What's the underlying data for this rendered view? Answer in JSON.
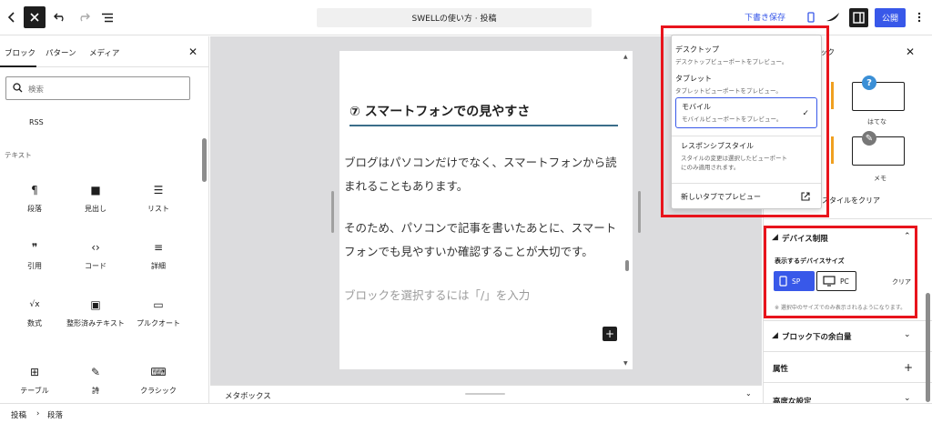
{
  "topbar": {
    "doc_title": "SWELLの使い方 · 投稿",
    "save_draft": "下書き保存",
    "publish": "公開",
    "accent": "#3858e9"
  },
  "inserter": {
    "tabs": [
      "ブロック",
      "パターン",
      "メディア"
    ],
    "search_placeholder": "検索",
    "rss": "RSS",
    "category": "テキスト",
    "blocks": [
      {
        "label": "段落",
        "icon": "paragraph-icon",
        "glyph": "¶"
      },
      {
        "label": "見出し",
        "icon": "bookmark-icon",
        "glyph": "■"
      },
      {
        "label": "リスト",
        "icon": "list-icon",
        "glyph": "☰"
      },
      {
        "label": "引用",
        "icon": "quote-icon",
        "glyph": "❞"
      },
      {
        "label": "コード",
        "icon": "code-icon",
        "glyph": "‹›"
      },
      {
        "label": "詳細",
        "icon": "details-icon",
        "glyph": "≡"
      },
      {
        "label": "数式",
        "icon": "math-icon",
        "glyph": "√x"
      },
      {
        "label": "整形済みテキスト",
        "icon": "preformatted-icon",
        "glyph": "▣"
      },
      {
        "label": "プルクオート",
        "icon": "pullquote-icon",
        "glyph": "▭"
      },
      {
        "label": "テーブル",
        "icon": "table-icon",
        "glyph": "⊞"
      },
      {
        "label": "詩",
        "icon": "feather-icon",
        "glyph": "✎"
      },
      {
        "label": "クラシック",
        "icon": "keyboard-icon",
        "glyph": "⌨"
      }
    ]
  },
  "canvas": {
    "heading": "⑦ スマートフォンでの見やすさ",
    "para1": "ブログはパソコンだけでなく、スマートフォンから読まれることもあります。",
    "para2": "そのため、パソコンで記事を書いたあとに、スマートフォンでも見やすいか確認することが大切です。",
    "placeholder": "ブロックを選択するには「/」を入力"
  },
  "metabox": {
    "label": "メタボックス"
  },
  "preview_menu": {
    "items": [
      {
        "label": "デスクトップ",
        "desc": "デスクトップビューポートをプレビュー。"
      },
      {
        "label": "タブレット",
        "desc": "タブレットビューポートをプレビュー。"
      },
      {
        "label": "モバイル",
        "desc": "モバイルビューポートをプレビュー。"
      },
      {
        "label": "レスポンシブスタイル",
        "desc": "スタイルの変更は選択したビューポートにのみ適用されます。"
      }
    ],
    "new_tab": "新しいタブでプレビュー"
  },
  "settings": {
    "tab_partial": "ック",
    "style_hatena": "はてな",
    "style_memo": "メモ",
    "clear_style": "スタイルをクリア",
    "device_panel": {
      "title": "デバイス制限",
      "subtitle": "表示するデバイスサイズ",
      "sp": "SP",
      "pc": "PC",
      "clear": "クリア",
      "note": "※ 選択中のサイズでのみ表示されるようになります。"
    },
    "panels": [
      "ブロック下の余白量",
      "属性",
      "高度な設定"
    ]
  },
  "footer": {
    "crumbs": [
      "投稿",
      "段落"
    ]
  }
}
